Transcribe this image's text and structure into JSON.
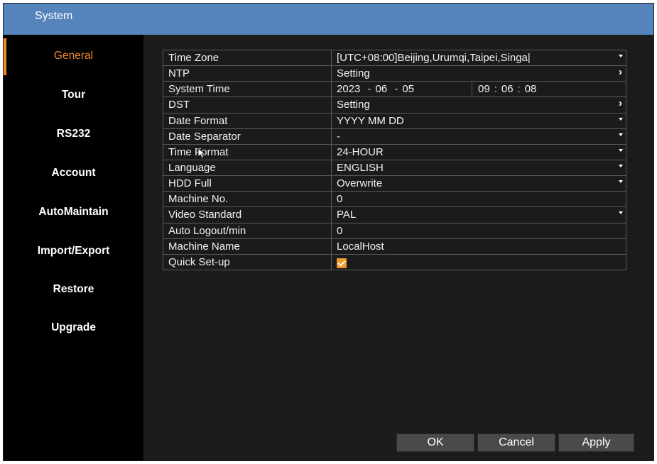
{
  "window": {
    "title": "System"
  },
  "sidebar": {
    "items": [
      {
        "label": "General",
        "active": true
      },
      {
        "label": "Tour"
      },
      {
        "label": "RS232"
      },
      {
        "label": "Account"
      },
      {
        "label": "AutoMaintain"
      },
      {
        "label": "Import/Export"
      },
      {
        "label": "Restore"
      },
      {
        "label": "Upgrade"
      }
    ]
  },
  "settings": {
    "time_zone": {
      "label": "Time Zone",
      "value": "[UTC+08:00]Beijing,Urumqi,Taipei,Singa|"
    },
    "ntp": {
      "label": "NTP",
      "value": "Setting"
    },
    "system_time": {
      "label": "System Time",
      "year": "2023",
      "month": "06",
      "day": "05",
      "hour": "09",
      "minute": "06",
      "second": "08",
      "date_sep": "-",
      "time_sep": ":"
    },
    "dst": {
      "label": "DST",
      "value": "Setting"
    },
    "date_format": {
      "label": "Date Format",
      "value": "YYYY MM DD"
    },
    "date_separator": {
      "label": "Date Separator",
      "value": "-"
    },
    "time_format": {
      "label": "Time Format",
      "value": "24-HOUR"
    },
    "language": {
      "label": "Language",
      "value": "ENGLISH"
    },
    "hdd_full": {
      "label": "HDD Full",
      "value": "Overwrite"
    },
    "machine_no": {
      "label": "Machine No.",
      "value": "0"
    },
    "video_standard": {
      "label": "Video Standard",
      "value": "PAL"
    },
    "auto_logout": {
      "label": "Auto Logout/min",
      "value": "0"
    },
    "machine_name": {
      "label": "Machine Name",
      "value": "LocalHost"
    },
    "quick_setup": {
      "label": "Quick Set-up",
      "checked": true
    }
  },
  "buttons": {
    "ok": "OK",
    "cancel": "Cancel",
    "apply": "Apply"
  },
  "colors": {
    "accent": "#ef8a2c",
    "titlebar": "#5584bd",
    "panel": "#1b1b1b",
    "sidebar": "#000000"
  }
}
